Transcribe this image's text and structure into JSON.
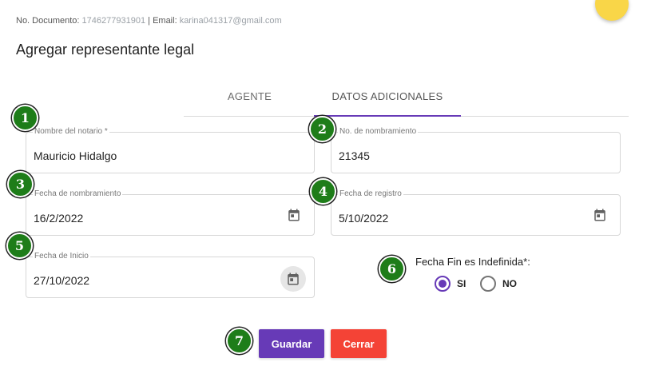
{
  "header": {
    "doc_label": "No. Documento:",
    "doc_value": "1746277931901",
    "separator": "|",
    "email_label": "Email:",
    "email_value": "karina041317@gmail.com"
  },
  "title": "Agregar representante legal",
  "tabs": [
    {
      "label": "AGENTE",
      "active": false
    },
    {
      "label": "DATOS ADICIONALES",
      "active": true
    }
  ],
  "fields": {
    "notario": {
      "label": "Nombre del notario *",
      "value": "Mauricio Hidalgo"
    },
    "nombramiento_no": {
      "label": "No. de nombramiento",
      "value": "21345"
    },
    "fecha_nombramiento": {
      "label": "Fecha de nombramiento",
      "value": "16/2/2022",
      "icon": "calendar-icon"
    },
    "fecha_registro": {
      "label": "Fecha de registro",
      "value": "5/10/2022",
      "icon": "calendar-icon"
    },
    "fecha_inicio": {
      "label": "Fecha de Inicio",
      "value": "27/10/2022",
      "icon": "calendar-icon"
    }
  },
  "fecha_fin": {
    "label": "Fecha Fin es Indefinida*:",
    "options": [
      {
        "label": "SI",
        "checked": true
      },
      {
        "label": "NO",
        "checked": false
      }
    ]
  },
  "markers": [
    "1",
    "2",
    "3",
    "4",
    "5",
    "6",
    "7"
  ],
  "buttons": {
    "save": "Guardar",
    "close": "Cerrar"
  },
  "colors": {
    "primary": "#673ab7",
    "danger": "#f44336",
    "marker": "#1e7d19",
    "avatar": "#f9d648"
  }
}
